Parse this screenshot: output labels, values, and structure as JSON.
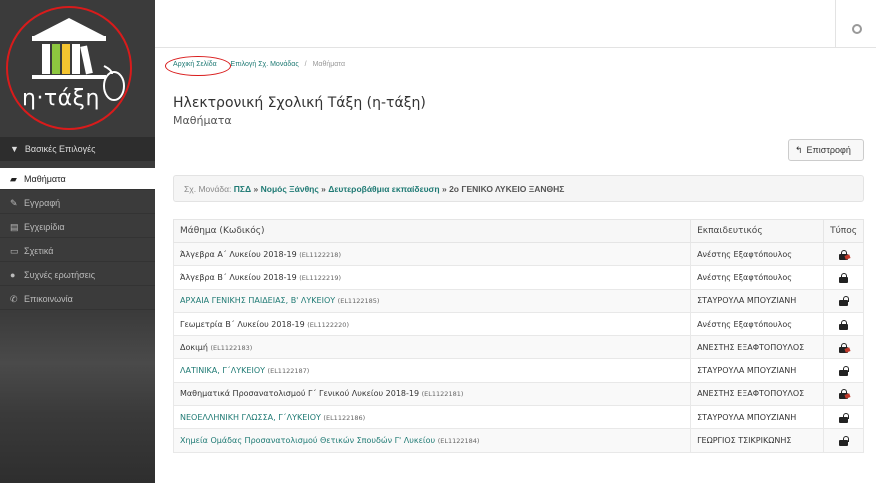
{
  "logo": {
    "text": "η·τάξη"
  },
  "sidebar": {
    "header": "Βασικές Επιλογές",
    "items": [
      {
        "label": "Μαθήματα",
        "icon": "graduation-cap-icon",
        "active": true
      },
      {
        "label": "Εγγραφή",
        "icon": "edit-icon",
        "active": false
      },
      {
        "label": "Εγχειρίδια",
        "icon": "file-icon",
        "active": false
      },
      {
        "label": "Σχετικά",
        "icon": "card-icon",
        "active": false
      },
      {
        "label": "Συχνές ερωτήσεις",
        "icon": "question-icon",
        "active": false
      },
      {
        "label": "Επικοινωνία",
        "icon": "phone-icon",
        "active": false
      }
    ]
  },
  "breadcrumb": {
    "home": "Αρχική Σελίδα",
    "school": "Επιλογή Σχ. Μονάδας",
    "current": "Μαθήματα",
    "separator": "/"
  },
  "page": {
    "title": "Ηλεκτρονική Σχολική Τάξη (η-τάξη)",
    "subtitle": "Μαθήματα",
    "back_label": "Επιστροφή"
  },
  "school_bar": {
    "prefix": "Σχ. Μονάδα:",
    "psd": "ΠΣΔ",
    "sep1": "»",
    "nomos": "Νομός Ξάνθης",
    "sep2": "»",
    "level": "Δευτεροβάθμια εκπαίδευση",
    "sep3": "»",
    "school": "2ο ΓΕΝΙΚΟ ΛΥΚΕΙΟ ΞΑΝΘΗΣ"
  },
  "table": {
    "headers": [
      "Μάθημα (Κωδικός)",
      "Εκπαιδευτικός",
      "Τύπος"
    ],
    "rows": [
      {
        "course": "Άλγεβρα Α΄ Λυκείου 2018-19",
        "code": "(EL1122218)",
        "teacher": "Ανέστης Εξαφτόπουλος",
        "link": false,
        "lock": "red"
      },
      {
        "course": "Άλγεβρα Β΄ Λυκείου 2018-19",
        "code": "(EL1122219)",
        "teacher": "Ανέστης Εξαφτόπουλος",
        "link": false,
        "lock": "closed"
      },
      {
        "course": "ΑΡΧΑΙΑ ΓΕΝΙΚΗΣ ΠΑΙΔΕΙΑΣ, Β' ΛΥΚΕΙΟΥ",
        "code": "(EL1122185)",
        "teacher": "ΣΤΑΥΡΟΥΛΑ ΜΠΟΥΖΙΑΝΗ",
        "link": true,
        "lock": "open"
      },
      {
        "course": "Γεωμετρία Β΄ Λυκείου 2018-19",
        "code": "(EL1122220)",
        "teacher": "Ανέστης Εξαφτόπουλος",
        "link": false,
        "lock": "closed"
      },
      {
        "course": "Δοκιμή",
        "code": "(EL1122183)",
        "teacher": "ΑΝΕΣΤΗΣ ΕΞΑΦΤΟΠΟΥΛΟΣ",
        "link": false,
        "lock": "red"
      },
      {
        "course": "ΛΑΤΙΝΙΚΑ, Γ΄ΛΥΚΕΙΟΥ",
        "code": "(EL1122187)",
        "teacher": "ΣΤΑΥΡΟΥΛΑ ΜΠΟΥΖΙΑΝΗ",
        "link": true,
        "lock": "open"
      },
      {
        "course": "Μαθηματικά Προσανατολισμού Γ΄ Γενικού Λυκείου 2018-19",
        "code": "(EL1122181)",
        "teacher": "ΑΝΕΣΤΗΣ ΕΞΑΦΤΟΠΟΥΛΟΣ",
        "link": false,
        "lock": "red"
      },
      {
        "course": "ΝΕΟΕΛΛΗΝΙΚΗ ΓΛΩΣΣΑ, Γ΄ΛΥΚΕΙΟΥ",
        "code": "(EL1122186)",
        "teacher": "ΣΤΑΥΡΟΥΛΑ ΜΠΟΥΖΙΑΝΗ",
        "link": true,
        "lock": "open"
      },
      {
        "course": "Χημεία Ομάδας Προσανατολισμού Θετικών Σπουδών Γ' Λυκείου",
        "code": "(EL1122184)",
        "teacher": "ΓΕΩΡΓΙΟΣ ΤΣΙΚΡΙΚΩΝΗΣ",
        "link": true,
        "lock": "open"
      }
    ]
  },
  "colors": {
    "accent": "#1f7a74",
    "sidebar": "#3b3b3b",
    "annotation": "#d91b1b"
  }
}
